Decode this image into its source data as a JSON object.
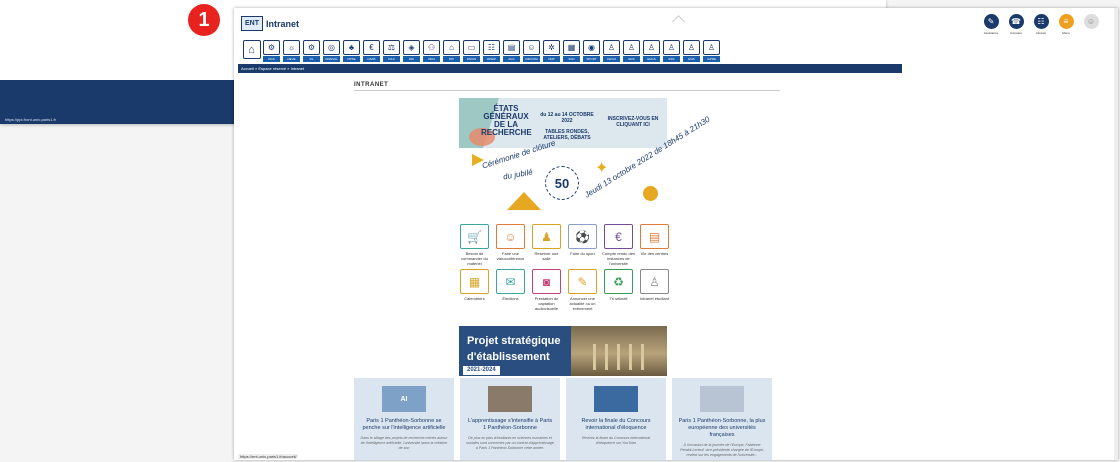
{
  "badge": "1",
  "background_window": {
    "status_url": "https://ppi-front.univ-paris1.fr"
  },
  "header": {
    "logo_badge": "ENT",
    "logo_text": "Intranet",
    "top_icons": [
      {
        "name": "assistance",
        "label": "Assistance",
        "glyph": "✎"
      },
      {
        "name": "annuaire",
        "label": "Annuaire",
        "glyph": "☎"
      },
      {
        "name": "intranet",
        "label": "Intranet",
        "glyph": "☷"
      },
      {
        "name": "menu",
        "label": "Menu",
        "glyph": "≡"
      },
      {
        "name": "user",
        "label": "",
        "glyph": "☺"
      }
    ]
  },
  "nav": {
    "home_glyph": "⌂",
    "items": [
      {
        "label": "DGS",
        "glyph": "⚙"
      },
      {
        "label": "DEVE",
        "glyph": "☼"
      },
      {
        "label": "DL",
        "glyph": "⚙"
      },
      {
        "label": "DIREVAL",
        "glyph": "◎"
      },
      {
        "label": "DPSE",
        "glyph": "♣"
      },
      {
        "label": "DAFB",
        "glyph": "€"
      },
      {
        "label": "DAJI",
        "glyph": "⚖"
      },
      {
        "label": "DRI",
        "glyph": "◈"
      },
      {
        "label": "DRH",
        "glyph": "⚇"
      },
      {
        "label": "DPI",
        "glyph": "⌂"
      },
      {
        "label": "DSIUN",
        "glyph": "▭"
      },
      {
        "label": "DPEIP",
        "glyph": "☷"
      },
      {
        "label": "AGC",
        "glyph": "▤"
      },
      {
        "label": "DIRCOM",
        "glyph": "☺"
      },
      {
        "label": "DDP",
        "glyph": "✲"
      },
      {
        "label": "SCD",
        "glyph": "▦"
      },
      {
        "label": "SPORT",
        "glyph": "◉"
      },
      {
        "label": "CEVUI",
        "glyph": "♙"
      },
      {
        "label": "EDS",
        "glyph": "♙"
      },
      {
        "label": "EDGS",
        "glyph": "♙"
      },
      {
        "label": "ESS",
        "glyph": "♙"
      },
      {
        "label": "EMS",
        "glyph": "♙"
      },
      {
        "label": "IAPRE",
        "glyph": "♙"
      }
    ]
  },
  "breadcrumb": "Accueil » Espace réservé » Intranet",
  "page_title": "INTRANET",
  "banner_recherche": {
    "title": "ÉTATS GÉNÉRAUX DE LA RECHERCHE",
    "date": "du 12 au 14 OCTOBRE 2022",
    "subtitle": "TABLES RONDES, ATELIERS, DÉBATS",
    "cta": "INSCRIVEZ-VOUS EN CLIQUANT ICI"
  },
  "banner_jubile": {
    "text_left_1": "Cérémonie de clôture",
    "text_left_2": "du jubilé",
    "seal_number": "50",
    "text_right": "Jeudi 13 octobre 2022 de 18h45 à 21h30"
  },
  "quick_links": [
    {
      "name": "besoin-materiel",
      "label": "Besoin de commander du matériel",
      "glyph": "🛒",
      "color": "#3aa6a0"
    },
    {
      "name": "visioconference",
      "label": "Faire une visioconférence",
      "glyph": "☺",
      "color": "#e07b39"
    },
    {
      "name": "reserver-salle",
      "label": "Réserver une salle",
      "glyph": "♟",
      "color": "#d8a428"
    },
    {
      "name": "faire-du-sport",
      "label": "Faire du sport",
      "glyph": "⚽",
      "color": "#8aa0c8"
    },
    {
      "name": "compte-rendu",
      "label": "Compte rendu des instances de l'université",
      "glyph": "€",
      "color": "#7a4a9a"
    },
    {
      "name": "vie-centres",
      "label": "Vie des centres",
      "glyph": "▤",
      "color": "#e07b39"
    },
    {
      "name": "calendriers",
      "label": "Calendriers",
      "glyph": "▦",
      "color": "#d8a428"
    },
    {
      "name": "elections",
      "label": "Élections",
      "glyph": "✉",
      "color": "#3aa6a0"
    },
    {
      "name": "prestation-captation",
      "label": "Prestation de captation audiovisuelle",
      "glyph": "◙",
      "color": "#c8407a"
    },
    {
      "name": "annoncer-actualite",
      "label": "Annoncer une actualité ou un évènement",
      "glyph": "✎",
      "color": "#d8a428"
    },
    {
      "name": "tri-selectif",
      "label": "Tri sélectif",
      "glyph": "♻",
      "color": "#3a9a5a"
    },
    {
      "name": "intranet-etudiant",
      "label": "Intranet étudiant",
      "glyph": "♙",
      "color": "#8a8a8a"
    }
  ],
  "banner_projet": {
    "title_1": "Projet stratégique",
    "title_2": "d'établissement",
    "years": "2021-2024"
  },
  "news_cards": [
    {
      "title": "Paris 1 Panthéon-Sorbonne se penche sur l'intelligence artificielle",
      "desc": "Dans le sillage des projets de recherche menés autour de l'intelligence artificielle, l'université lance la création de son",
      "image_color": "#7da1c7",
      "image_label": "AI"
    },
    {
      "title": "L'apprentissage s'intensifie à Paris 1 Panthéon-Sorbonne",
      "desc": "De plus en plus d'étudiants en sciences humaines et sociales sont concernés par un contrat d'apprentissage à Paris 1 Panthéon-Sorbonne cette année.",
      "image_color": "#8a7a6a",
      "image_label": ""
    },
    {
      "title": "Revoir la finale du Concours international d'éloquence",
      "desc": "Revivez la finale du Concours international d'éloquence sur YouTube",
      "image_color": "#3a6aa0",
      "image_label": ""
    },
    {
      "title": "Paris 1 Panthéon-Sorbonne, la plus européenne des universités françaises",
      "desc": "À l'occasion de la journée de l'Europe, Fabienne Peraldi-Leneuf, vice-présidente chargée de l'Europe, revient sur les engagements de l'université...",
      "image_color": "#b8c4d4",
      "image_label": ""
    }
  ],
  "status_link": "https://ent.univ-paris1.fr/accueil/"
}
